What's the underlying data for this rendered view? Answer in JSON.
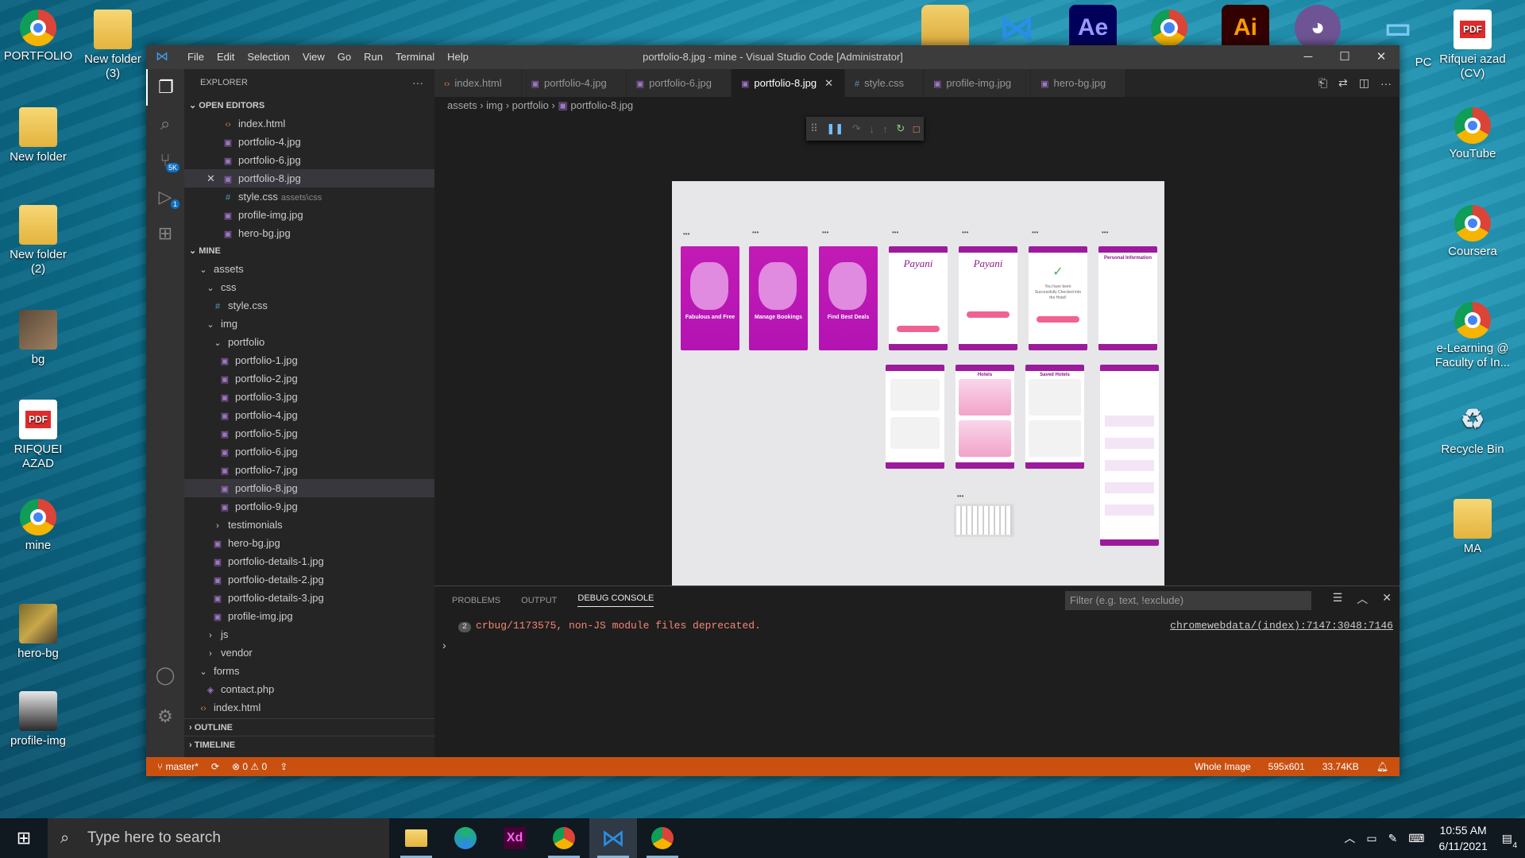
{
  "desktop": {
    "left_icons": [
      {
        "label": "PORTFOLIO",
        "kind": "chrome"
      },
      {
        "label": "New folder\n(3)",
        "kind": "folder"
      },
      {
        "label": "New folder",
        "kind": "folder"
      },
      {
        "label": "New folder\n(2)",
        "kind": "folder"
      },
      {
        "label": "bg",
        "kind": "photo"
      },
      {
        "label": "RIFQUEI\nAZAD",
        "kind": "pdf"
      },
      {
        "label": "mine",
        "kind": "chrome"
      },
      {
        "label": "hero-bg",
        "kind": "photo"
      },
      {
        "label": "profile-img",
        "kind": "photo"
      }
    ],
    "right_icons": [
      {
        "label": "Rifquei azad\n(CV)"
      },
      {
        "label": "YouTube"
      },
      {
        "label": "Coursera"
      },
      {
        "label": "e-Learning @\nFaculty of In..."
      },
      {
        "label": "Recycle Bin"
      },
      {
        "label": "MA"
      }
    ],
    "pc_label": "PC",
    "pdf_text": "PDF"
  },
  "window": {
    "title": "portfolio-8.jpg - mine - Visual Studio Code [Administrator]",
    "menu": [
      "File",
      "Edit",
      "Selection",
      "View",
      "Go",
      "Run",
      "Terminal",
      "Help"
    ],
    "controls": {
      "minimize": "─",
      "maximize": "☐",
      "close": "✕"
    }
  },
  "activity": {
    "scm_badge": "5K",
    "debug_badge": "1"
  },
  "explorer": {
    "title": "EXPLORER",
    "open_editors_label": "OPEN EDITORS",
    "open_editors": [
      {
        "name": "index.html",
        "type": "htm",
        "sub": ""
      },
      {
        "name": "portfolio-4.jpg",
        "type": "img",
        "sub": ""
      },
      {
        "name": "portfolio-6.jpg",
        "type": "img",
        "sub": ""
      },
      {
        "name": "portfolio-8.jpg",
        "type": "img",
        "sub": "",
        "selected": true
      },
      {
        "name": "style.css",
        "type": "css",
        "sub": "assets\\css"
      },
      {
        "name": "profile-img.jpg",
        "type": "img",
        "sub": ""
      },
      {
        "name": "hero-bg.jpg",
        "type": "img",
        "sub": ""
      }
    ],
    "workspace_label": "MINE",
    "tree": [
      {
        "name": "assets",
        "depth": 1,
        "type": "open"
      },
      {
        "name": "css",
        "depth": 2,
        "type": "open"
      },
      {
        "name": "style.css",
        "depth": 3,
        "type": "css"
      },
      {
        "name": "img",
        "depth": 2,
        "type": "open"
      },
      {
        "name": "portfolio",
        "depth": 3,
        "type": "open"
      },
      {
        "name": "portfolio-1.jpg",
        "depth": 4,
        "type": "img"
      },
      {
        "name": "portfolio-2.jpg",
        "depth": 4,
        "type": "img"
      },
      {
        "name": "portfolio-3.jpg",
        "depth": 4,
        "type": "img"
      },
      {
        "name": "portfolio-4.jpg",
        "depth": 4,
        "type": "img"
      },
      {
        "name": "portfolio-5.jpg",
        "depth": 4,
        "type": "img"
      },
      {
        "name": "portfolio-6.jpg",
        "depth": 4,
        "type": "img"
      },
      {
        "name": "portfolio-7.jpg",
        "depth": 4,
        "type": "img"
      },
      {
        "name": "portfolio-8.jpg",
        "depth": 4,
        "type": "img",
        "selected": true
      },
      {
        "name": "portfolio-9.jpg",
        "depth": 4,
        "type": "img"
      },
      {
        "name": "testimonials",
        "depth": 3,
        "type": "closed"
      },
      {
        "name": "hero-bg.jpg",
        "depth": 3,
        "type": "img"
      },
      {
        "name": "portfolio-details-1.jpg",
        "depth": 3,
        "type": "img"
      },
      {
        "name": "portfolio-details-2.jpg",
        "depth": 3,
        "type": "img"
      },
      {
        "name": "portfolio-details-3.jpg",
        "depth": 3,
        "type": "img"
      },
      {
        "name": "profile-img.jpg",
        "depth": 3,
        "type": "img"
      },
      {
        "name": "js",
        "depth": 2,
        "type": "closed"
      },
      {
        "name": "vendor",
        "depth": 2,
        "type": "closed"
      },
      {
        "name": "forms",
        "depth": 1,
        "type": "open"
      },
      {
        "name": "contact.php",
        "depth": 2,
        "type": "php"
      },
      {
        "name": "index.html",
        "depth": 1,
        "type": "htm"
      }
    ],
    "outline_label": "OUTLINE",
    "timeline_label": "TIMELINE"
  },
  "tabs": [
    {
      "name": "index.html",
      "type": "htm",
      "active": false
    },
    {
      "name": "portfolio-4.jpg",
      "type": "img",
      "active": false
    },
    {
      "name": "portfolio-6.jpg",
      "type": "img",
      "active": false
    },
    {
      "name": "portfolio-8.jpg",
      "type": "img",
      "active": true
    },
    {
      "name": "style.css",
      "type": "css",
      "active": false
    },
    {
      "name": "profile-img.jpg",
      "type": "img",
      "active": false
    },
    {
      "name": "hero-bg.jpg",
      "type": "img",
      "active": false
    }
  ],
  "breadcrumbs": [
    "assets",
    "img",
    "portfolio",
    "portfolio-8.jpg"
  ],
  "mockup": {
    "onboard": [
      "Fabulous and Free",
      "Manage Bookings",
      "Find Best Deals"
    ],
    "brand": "Payani",
    "success": "You have been Successfully Checked into the Hotel!",
    "personal": "Personal Information",
    "hotels": "Hotels",
    "saved": "Saved Hotels",
    "dots": "•••"
  },
  "panel": {
    "tabs": [
      "PROBLEMS",
      "OUTPUT",
      "DEBUG CONSOLE"
    ],
    "filter_placeholder": "Filter (e.g. text, !exclude)",
    "message_count": "2",
    "message": "crbug/1173575, non-JS module files deprecated.",
    "source_link": "chromewebdata/(index):7147:3048:7146",
    "prompt": "›"
  },
  "status": {
    "branch": "master*",
    "errors": "0",
    "warnings": "0",
    "image_scope": "Whole Image",
    "dimensions": "595x601",
    "size": "33.74KB"
  },
  "taskbar": {
    "search_placeholder": "Type here to search",
    "time": "10:55 AM",
    "date": "6/11/2021",
    "notif_count": "4"
  }
}
